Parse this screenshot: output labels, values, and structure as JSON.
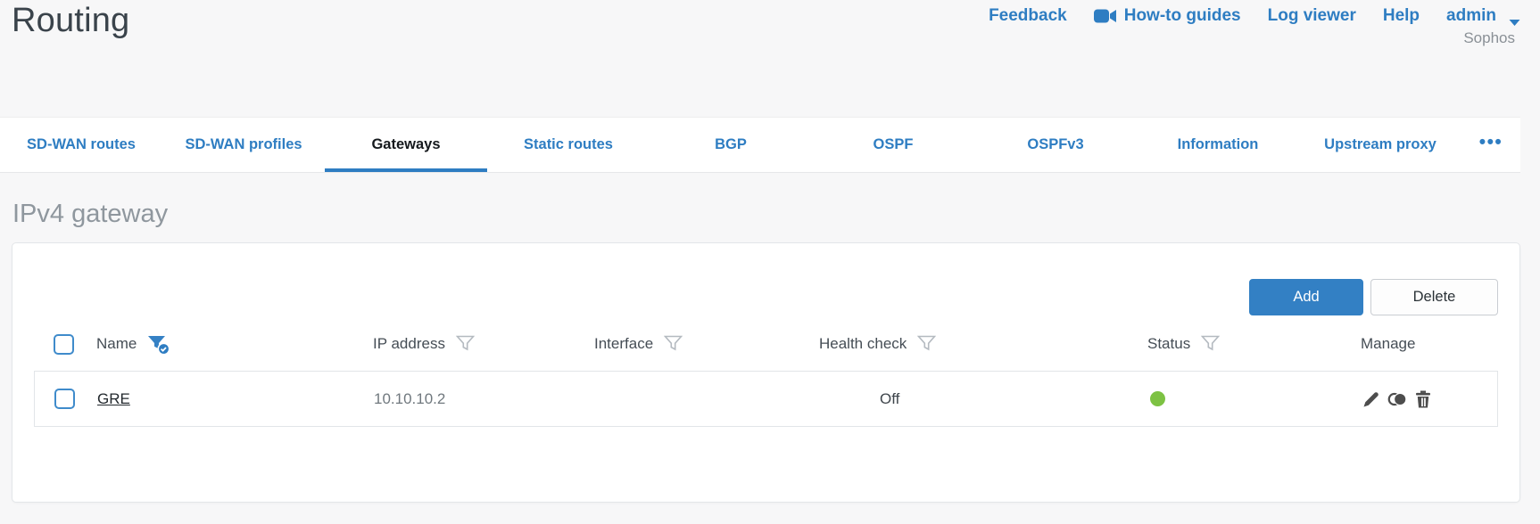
{
  "header": {
    "title": "Routing",
    "links": {
      "feedback": "Feedback",
      "howto": "How-to guides",
      "logviewer": "Log viewer",
      "help": "Help"
    },
    "user": "admin",
    "brand": "Sophos"
  },
  "tabs": [
    {
      "label": "SD-WAN routes",
      "active": false
    },
    {
      "label": "SD-WAN profiles",
      "active": false
    },
    {
      "label": "Gateways",
      "active": true
    },
    {
      "label": "Static routes",
      "active": false
    },
    {
      "label": "BGP",
      "active": false
    },
    {
      "label": "OSPF",
      "active": false
    },
    {
      "label": "OSPFv3",
      "active": false
    },
    {
      "label": "Information",
      "active": false
    },
    {
      "label": "Upstream proxy",
      "active": false
    }
  ],
  "tabs_overflow": "•••",
  "section": {
    "title": "IPv4 gateway"
  },
  "toolbar": {
    "add_label": "Add",
    "delete_label": "Delete"
  },
  "table": {
    "columns": [
      "Name",
      "IP address",
      "Interface",
      "Health check",
      "Status",
      "Manage"
    ],
    "name_filter_active": true,
    "rows": [
      {
        "name": "GRE",
        "ip_address": "10.10.10.2",
        "interface": "",
        "health_check": "Off",
        "status": "on"
      }
    ]
  },
  "icons": {
    "howto": "video-camera-icon",
    "user_caret": "chevron-down-icon",
    "filter": "funnel-icon",
    "manage": [
      "edit-pencil-icon",
      "clone-icon",
      "trash-icon"
    ],
    "status": "green-dot"
  },
  "colors": {
    "accent_blue": "#2e7dc2",
    "button_blue": "#3380c4",
    "status_green": "#7dc243",
    "background": "#f7f7f8"
  }
}
